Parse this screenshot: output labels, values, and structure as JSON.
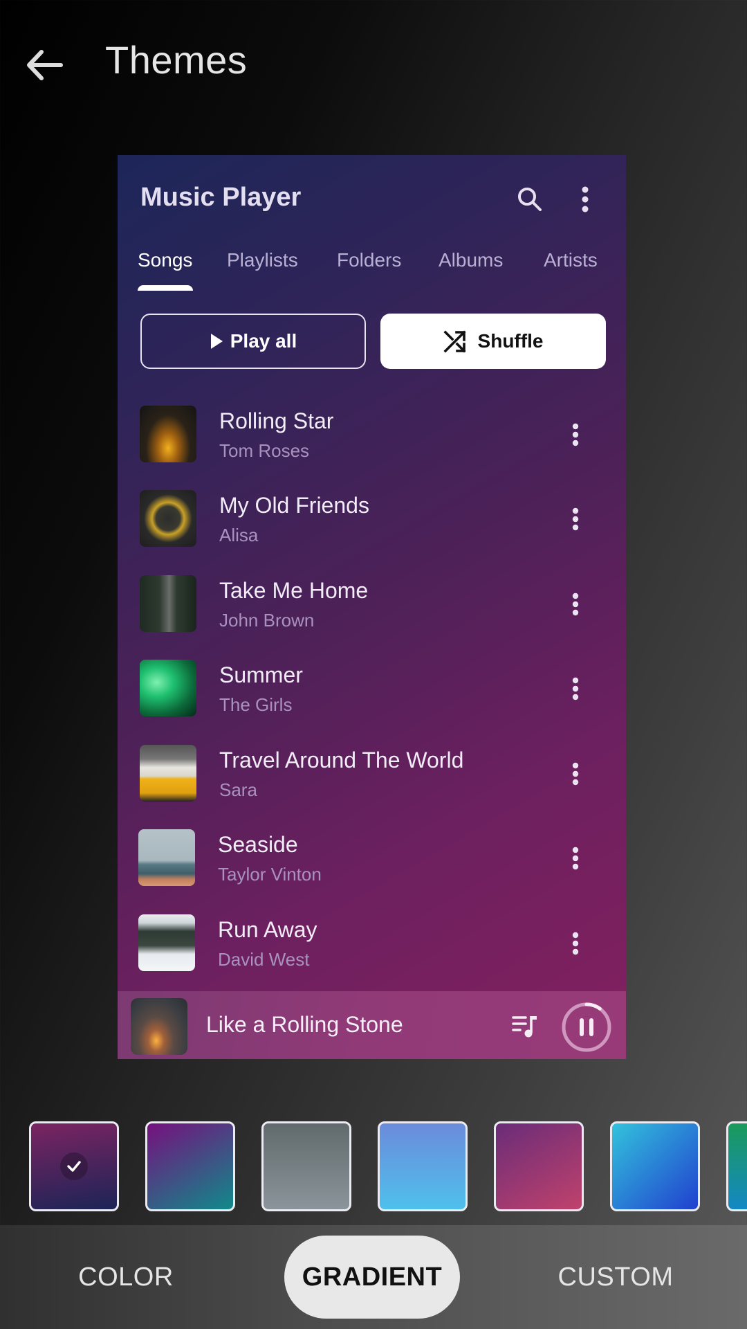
{
  "header": {
    "title": "Themes",
    "back_icon": "arrow-back-icon"
  },
  "preview": {
    "app_title": "Music Player",
    "icons": {
      "search": "search-icon",
      "more": "more-vertical-icon"
    },
    "tabs": [
      {
        "label": "Songs",
        "active": true
      },
      {
        "label": "Playlists",
        "active": false
      },
      {
        "label": "Folders",
        "active": false
      },
      {
        "label": "Albums",
        "active": false
      },
      {
        "label": "Artists",
        "active": false
      }
    ],
    "play_all_label": "Play all",
    "shuffle_label": "Shuffle",
    "songs": [
      {
        "title": "Rolling Star",
        "artist": "Tom Roses",
        "art": "concert-crowd-photo"
      },
      {
        "title": "My Old Friends",
        "artist": "Alisa",
        "art": "vinyl-record-photo"
      },
      {
        "title": "Take Me Home",
        "artist": "John Brown",
        "art": "forest-road-photo"
      },
      {
        "title": "Summer",
        "artist": "The Girls",
        "art": "green-concert-photo"
      },
      {
        "title": "Travel Around The World",
        "artist": "Sara",
        "art": "yellow-van-photo"
      },
      {
        "title": "Seaside",
        "artist": "Taylor Vinton",
        "art": "seaside-photo"
      },
      {
        "title": "Run Away",
        "artist": "David West",
        "art": "snowy-forest-photo"
      }
    ],
    "now_playing": {
      "title": "Like a Rolling Stone",
      "art": "guitarist-photo",
      "progress": 0.1,
      "state": "playing"
    },
    "colors": {
      "accent_gradient": [
        "#1d2659",
        "#84205f"
      ],
      "mini_player": "#913a78"
    }
  },
  "swatches": [
    {
      "name": "purple-navy",
      "colors": [
        "#7b2462",
        "#1c2456"
      ],
      "angle": 170,
      "selected": true
    },
    {
      "name": "violet-teal",
      "colors": [
        "#76107e",
        "#108a8a"
      ],
      "angle": 150,
      "selected": false
    },
    {
      "name": "slate-gray",
      "colors": [
        "#616b6d",
        "#8a949a"
      ],
      "angle": 180,
      "selected": false
    },
    {
      "name": "periwinkle-sky",
      "colors": [
        "#6b8bdb",
        "#4fc0ec"
      ],
      "angle": 180,
      "selected": false
    },
    {
      "name": "plum-rose",
      "colors": [
        "#6a2c78",
        "#c0426c"
      ],
      "angle": 150,
      "selected": false
    },
    {
      "name": "cyan-blue",
      "colors": [
        "#33c2dc",
        "#2040cf"
      ],
      "angle": 135,
      "selected": false
    },
    {
      "name": "green-teal",
      "colors": [
        "#1b9a5a",
        "#1488c4"
      ],
      "angle": 180,
      "selected": false
    }
  ],
  "mode_tabs": [
    {
      "label": "COLOR",
      "active": false
    },
    {
      "label": "GRADIENT",
      "active": true
    },
    {
      "label": "CUSTOM",
      "active": false
    }
  ]
}
